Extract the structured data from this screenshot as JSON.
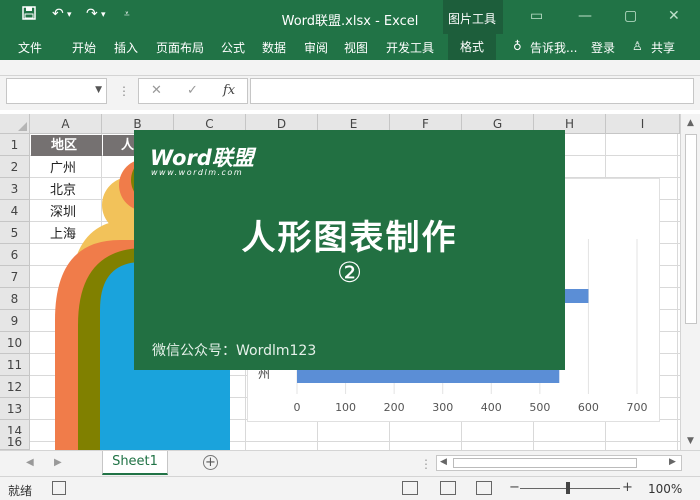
{
  "window": {
    "title": "Word联盟.xlsx - Excel",
    "context_group": "图片工具",
    "quick_access": [
      "save-icon",
      "undo-icon",
      "redo-icon",
      "customize-icon"
    ]
  },
  "ribbon": {
    "tabs": [
      "文件",
      "开始",
      "插入",
      "页面布局",
      "公式",
      "数据",
      "审阅",
      "视图",
      "开发工具"
    ],
    "format_tab": "格式",
    "tell_me": "告诉我...",
    "login": "登录",
    "share": "共享"
  },
  "formula_bar": {
    "namebox_value": "",
    "cancel_glyph": "✕",
    "enter_glyph": "✓",
    "fx_glyph": "fx",
    "formula_value": ""
  },
  "sheet": {
    "columns": [
      "A",
      "B",
      "C",
      "D",
      "E",
      "F",
      "G",
      "H",
      "I"
    ],
    "rows": [
      "1",
      "2",
      "3",
      "4",
      "5",
      "6",
      "7",
      "8",
      "9",
      "10",
      "11",
      "12",
      "13",
      "14",
      "15",
      "16"
    ],
    "a1": "地区",
    "b1": "人",
    "cities": [
      "广州",
      "北京",
      "深圳",
      "上海"
    ]
  },
  "chart_data": {
    "type": "bar",
    "x_ticks": [
      "0",
      "100",
      "200",
      "300",
      "400",
      "500",
      "600",
      "700"
    ],
    "xlim": [
      0,
      700
    ],
    "categories": [
      "",
      ""
    ],
    "values": [
      600,
      540
    ],
    "y_fragment": "州",
    "bar_color": "#5b8ed6"
  },
  "overlay": {
    "brand": "Word联盟",
    "url": "www.wordlm.com",
    "title": "人形图表制作",
    "number": "②",
    "footer": "微信公众号：Wordlm123",
    "background": "#227042"
  },
  "sheet_tabs": {
    "active": "Sheet1",
    "add_glyph": "+"
  },
  "status": {
    "text": "就绪",
    "zoom": "100%",
    "zoom_minus": "−",
    "zoom_plus": "+"
  },
  "colors": {
    "excel_green": "#217346",
    "header_gray": "#757171",
    "person_colors": [
      "#f2c25a",
      "#f07c4a",
      "#808000",
      "#1aa3dc"
    ]
  }
}
